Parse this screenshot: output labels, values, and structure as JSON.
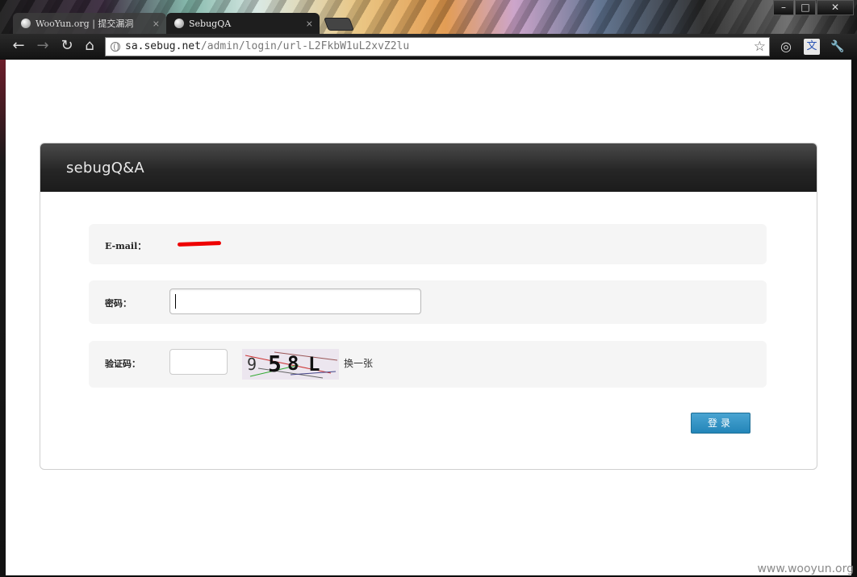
{
  "window": {
    "buttons": {
      "minimize": "–",
      "maximize": "□",
      "close": "✕"
    }
  },
  "tabs": [
    {
      "label": "WooYun.org | 提交漏洞",
      "close": "×"
    },
    {
      "label": "SebugQA",
      "close": "×"
    }
  ],
  "toolbar": {
    "back": "←",
    "forward": "→",
    "reload": "↻",
    "home": "⌂",
    "url_host": "sa.sebug.net",
    "url_path": "/admin/login/url-L2FkbW1uL2xvZ2lu",
    "star": "☆",
    "ext_globe": "◎",
    "ext_translate": "文",
    "wrench": "🔧"
  },
  "panel": {
    "brand": "sebugQ&A"
  },
  "form": {
    "email_label": "E-mail：",
    "password_label": "密码：",
    "captcha_label": "验证码：",
    "captcha_text": "958L",
    "refresh_label": "换一张",
    "login_label": "登录"
  },
  "watermark": "www.wooyun.org"
}
